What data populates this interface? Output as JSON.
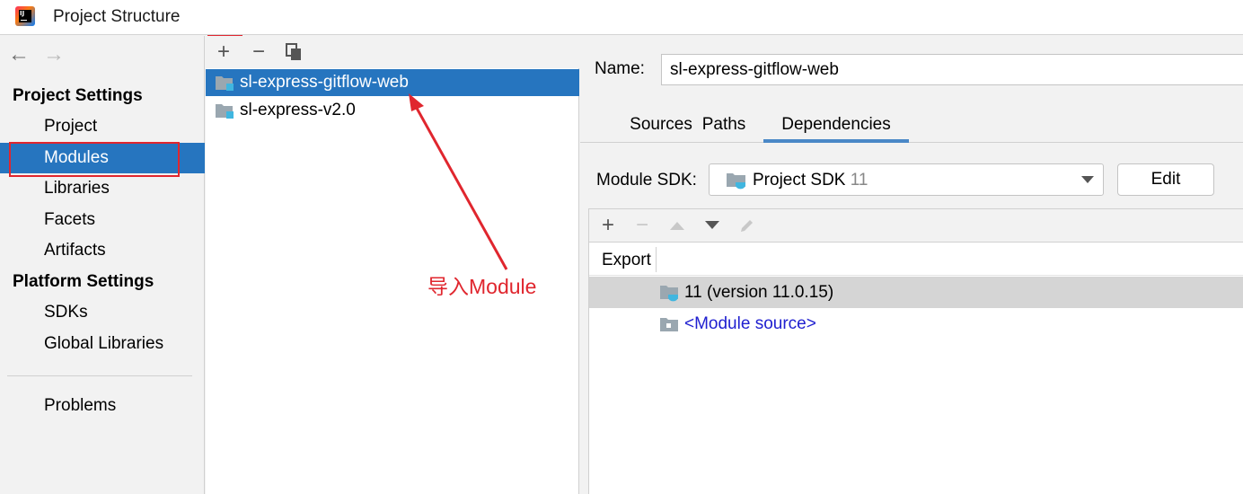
{
  "window": {
    "title": "Project Structure"
  },
  "left_nav": {
    "project_settings_header": "Project Settings",
    "project_items": [
      "Project",
      "Modules",
      "Libraries",
      "Facets",
      "Artifacts"
    ],
    "platform_settings_header": "Platform Settings",
    "platform_items": [
      "SDKs",
      "Global Libraries"
    ],
    "problems": "Problems",
    "selected": "Modules"
  },
  "modules": {
    "toolbar": {
      "add": "+",
      "remove": "−"
    },
    "items": [
      "sl-express-gitflow-web",
      "sl-express-v2.0"
    ],
    "selected": "sl-express-gitflow-web"
  },
  "annotation": {
    "text": "导入Module",
    "color": "#e0262e"
  },
  "details": {
    "name_label": "Name:",
    "name_value": "sl-express-gitflow-web",
    "tabs": [
      "Sources",
      "Paths",
      "Dependencies"
    ],
    "active_tab": "Dependencies",
    "sdk_label": "Module SDK:",
    "sdk_value": "Project SDK",
    "sdk_version": "11",
    "edit_button": "Edit",
    "dep_toolbar": {
      "add": "+",
      "remove": "−"
    },
    "dependencies_header": "Export",
    "dependencies": [
      "11 (version 11.0.15)",
      "<Module source>"
    ]
  },
  "colors": {
    "selection": "#2675bf",
    "accent_red": "#e0262e",
    "link_blue": "#2020d0"
  }
}
